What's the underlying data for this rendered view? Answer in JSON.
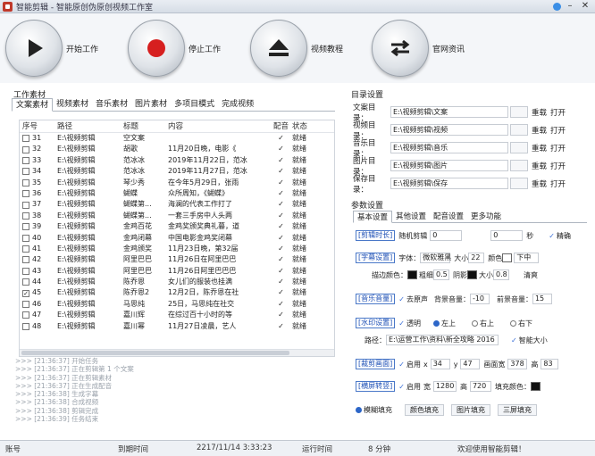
{
  "window": {
    "title": "智能剪辑 - 智能原创伪原创视频工作室"
  },
  "toolbar": {
    "start": "开始工作",
    "stop": "停止工作",
    "tutorial": "视频教程",
    "website": "官网资讯"
  },
  "work": {
    "title": "工作素材",
    "tabs": [
      "文案素材",
      "视频素材",
      "音乐素材",
      "图片素材",
      "多项目模式",
      "完成视频"
    ],
    "columns": [
      "序号",
      "路径",
      "标题",
      "内容",
      "配音",
      "状态"
    ],
    "rows": [
      {
        "no": "31",
        "path": "E:\\视频剪辑",
        "title": "空文案",
        "content": "",
        "dub": "✓",
        "status": "就绪",
        "checked": false
      },
      {
        "no": "32",
        "path": "E:\\视频剪辑",
        "title": "胡歌",
        "content": "11月20日晚，电影《",
        "dub": "✓",
        "status": "就绪",
        "checked": false
      },
      {
        "no": "33",
        "path": "E:\\视频剪辑",
        "title": "范冰冰",
        "content": "2019年11月22日，范冰",
        "dub": "✓",
        "status": "就绪",
        "checked": false
      },
      {
        "no": "34",
        "path": "E:\\视频剪辑",
        "title": "范冰冰",
        "content": "2019年11月27日，范冰",
        "dub": "✓",
        "status": "就绪",
        "checked": false
      },
      {
        "no": "35",
        "path": "E:\\视频剪辑",
        "title": "琴少秀",
        "content": "在今年5月29日，张雨",
        "dub": "✓",
        "status": "就绪",
        "checked": false
      },
      {
        "no": "36",
        "path": "E:\\视频剪辑",
        "title": "蝴蝶",
        "content": "众所周知，《蝴蝶》",
        "dub": "✓",
        "status": "就绪",
        "checked": false
      },
      {
        "no": "37",
        "path": "E:\\视频剪辑",
        "title": "蝴蝶第...",
        "content": "海澜的代表工作打了",
        "dub": "✓",
        "status": "就绪",
        "checked": false
      },
      {
        "no": "38",
        "path": "E:\\视频剪辑",
        "title": "蝴蝶第...",
        "content": "一套三手房中人头两",
        "dub": "✓",
        "status": "就绪",
        "checked": false
      },
      {
        "no": "39",
        "path": "E:\\视频剪辑",
        "title": "金鸡百花",
        "content": "金鸡奖颁奖典礼暮，道",
        "dub": "✓",
        "status": "就绪",
        "checked": false
      },
      {
        "no": "40",
        "path": "E:\\视频剪辑",
        "title": "金鸡闭幕",
        "content": "中国电影金鸡奖闭幕",
        "dub": "✓",
        "status": "就绪",
        "checked": false
      },
      {
        "no": "41",
        "path": "E:\\视频剪辑",
        "title": "金鸡颁奖",
        "content": "11月23日晚，第32届",
        "dub": "✓",
        "status": "就绪",
        "checked": false
      },
      {
        "no": "42",
        "path": "E:\\视频剪辑",
        "title": "阿里巴巴",
        "content": "11月26日在阿里巴巴",
        "dub": "✓",
        "status": "就绪",
        "checked": false
      },
      {
        "no": "43",
        "path": "E:\\视频剪辑",
        "title": "阿里巴巴",
        "content": "11月26日阿里巴巴巴",
        "dub": "✓",
        "status": "就绪",
        "checked": false
      },
      {
        "no": "44",
        "path": "E:\\视频剪辑",
        "title": "陈乔恩",
        "content": "女儿们的服装也挂满",
        "dub": "✓",
        "status": "就绪",
        "checked": false
      },
      {
        "no": "45",
        "path": "E:\\视频剪辑",
        "title": "陈乔恩2",
        "content": "12月2日，陈乔恩在社",
        "dub": "✓",
        "status": "就绪",
        "checked": true
      },
      {
        "no": "46",
        "path": "E:\\视频剪辑",
        "title": "马思纯",
        "content": "25日，马思纯在社交",
        "dub": "✓",
        "status": "就绪",
        "checked": false
      },
      {
        "no": "47",
        "path": "E:\\视频剪辑",
        "title": "嘉川辉",
        "content": "在综过百十小时的等",
        "dub": "✓",
        "status": "就绪",
        "checked": false
      },
      {
        "no": "48",
        "path": "E:\\视频剪辑",
        "title": "嘉川幂",
        "content": "11月27日凌晨，艺人",
        "dub": "✓",
        "status": "就绪",
        "checked": false
      }
    ]
  },
  "log": [
    ">>> [21:36:37] 开始任务",
    ">>> [21:36:37] 正在剪辑第 1 个文案",
    ">>> [21:36:37] 正在剪辑素材",
    ">>> [21:36:37] 正在生成配音",
    ">>> [21:36:38] 生成字幕",
    ">>> [21:36:38] 合成视频",
    ">>> [21:36:38] 剪辑完成",
    ">>> [21:36:39] 任务结束"
  ],
  "dirs": {
    "title": "目录设置",
    "rows": [
      {
        "label": "文案目录：",
        "value": "E:\\视频剪辑\\文案"
      },
      {
        "label": "视频目录：",
        "value": "E:\\视频剪辑\\视频"
      },
      {
        "label": "音乐目录：",
        "value": "E:\\视频剪辑\\音乐"
      },
      {
        "label": "图片目录：",
        "value": "E:\\视频剪辑\\图片"
      },
      {
        "label": "保存目录：",
        "value": "E:\\视频剪辑\\保存"
      }
    ],
    "reload": "重载",
    "open": "打开"
  },
  "params": {
    "title": "参数设置",
    "tabs": [
      "基本设置",
      "其他设置",
      "配音设置",
      "更多功能"
    ],
    "clip": {
      "tag": "[剪辑时长]",
      "random": "随机剪辑",
      "start": "0",
      "end": "0",
      "unit": "秒",
      "precise": "精确"
    },
    "subtitle": {
      "tag": "[字幕设置]",
      "font_label": "字体：",
      "font": "微软雅黑",
      "size_label": "大小",
      "size": "22",
      "color_label": "颜色",
      "position": "下中",
      "stroke_label": "描边颜色：",
      "thick_label": "粗细",
      "thick": "0.5",
      "shadow_label": "阴影",
      "shadow_size_label": "大小",
      "shadow_size": "0.8",
      "extra": "清爽"
    },
    "audio": {
      "tag": "[音乐音量]",
      "mute": "去原声",
      "bg_label": "背景音量：",
      "bg": "-10",
      "dub_label": "前景音量：",
      "dub": "15"
    },
    "watermark": {
      "tag": "[水印设置]",
      "opt_label": "透明",
      "pos1": "左上",
      "pos2": "右上",
      "pos3": "右下",
      "path_label": "路径：",
      "path": "E:\\运营工作\\资料\\新全攻略 2016",
      "auto": "智能大小"
    },
    "crop": {
      "tag": "[裁剪画面]",
      "enable": "启用",
      "x_label": "x",
      "x": "34",
      "y_label": "y",
      "y": "47",
      "w_label": "画面宽",
      "w": "378",
      "h_label": "高",
      "h": "83"
    },
    "canvas": {
      "tag": "[横屏转竖]",
      "enable": "启用",
      "w_label": "宽",
      "w": "1280",
      "h_label": "高",
      "h": "720",
      "fill_label": "填充颜色："
    },
    "fill": {
      "blur": "模糊填充",
      "opt1": "颜色填充",
      "opt2": "图片填充",
      "opt3": "三屏填充"
    }
  },
  "status": {
    "acct": "账号",
    "expiry_label": "到期时间",
    "expiry": "2217/11/14 3:33:23",
    "runtime_label": "运行时间",
    "runtime": "8 分钟",
    "welcome": "欢迎使用智能剪辑！"
  },
  "colors": {
    "accent": "#2d66c8",
    "stop": "#d61f1f",
    "tag": "#1d4fb5"
  }
}
